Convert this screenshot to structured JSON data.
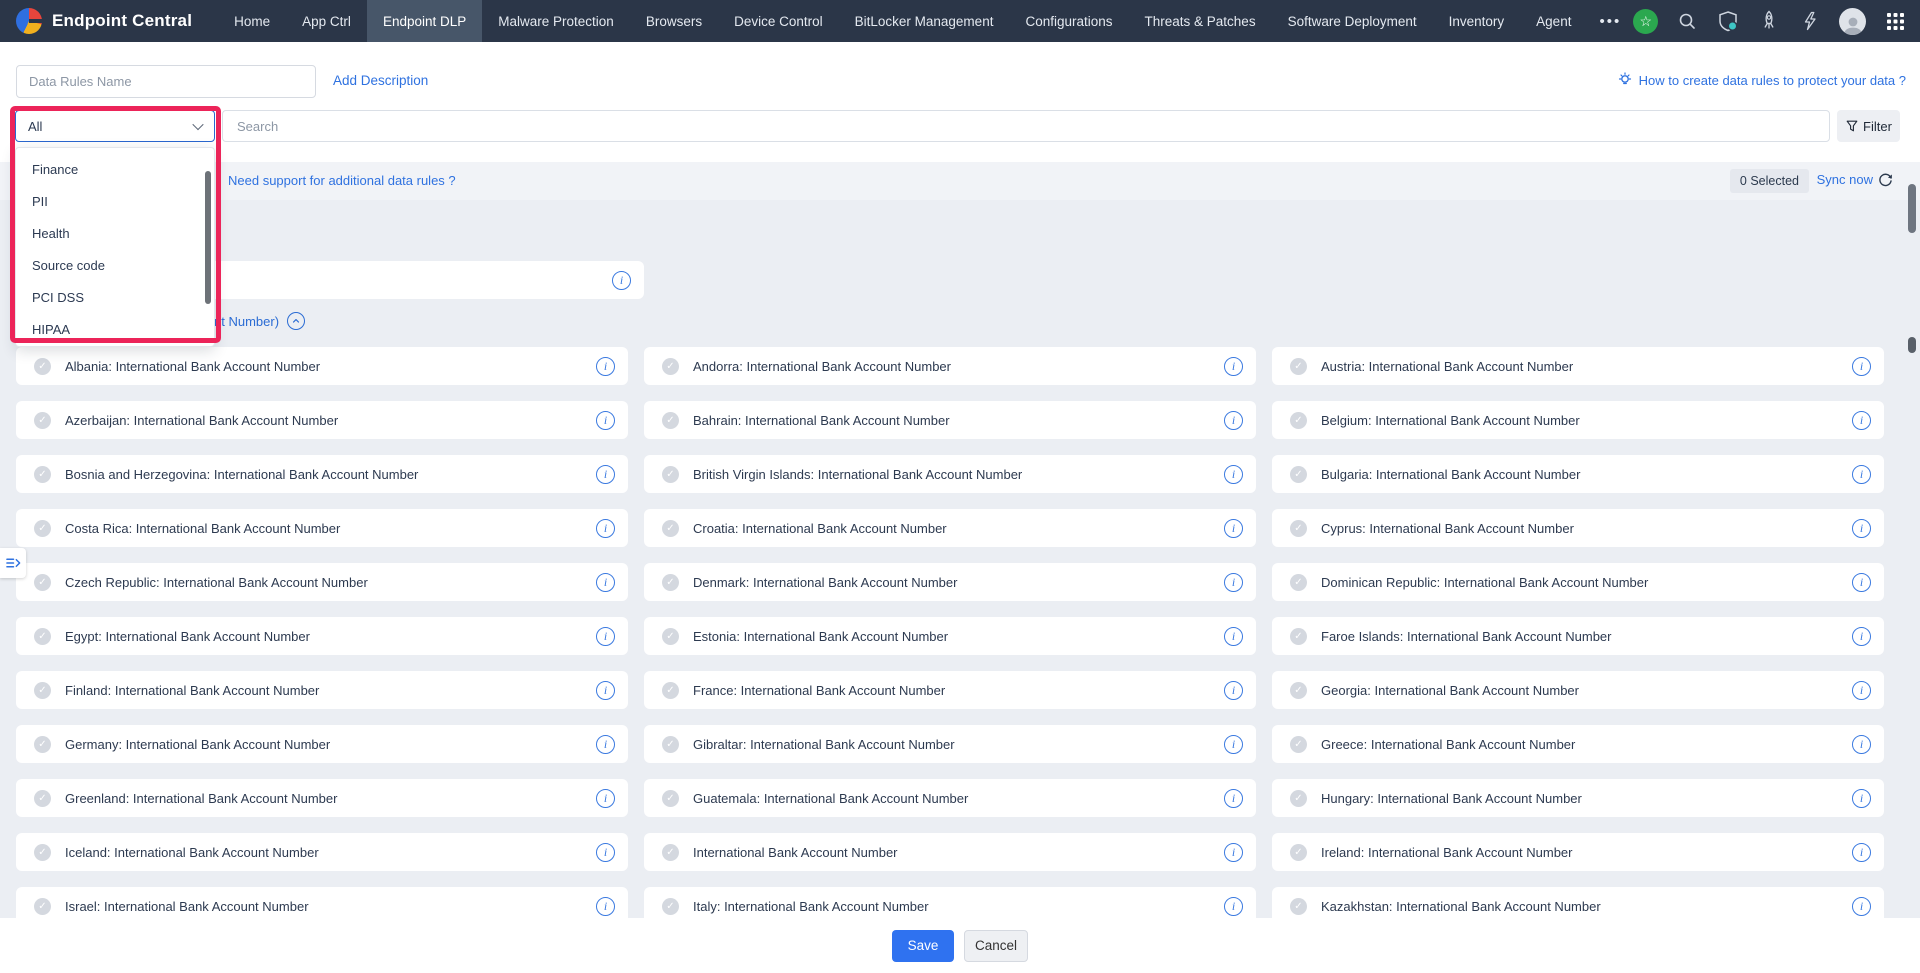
{
  "nav": {
    "brand": "Endpoint Central",
    "tabs": [
      {
        "label": "Home",
        "active": false
      },
      {
        "label": "App Ctrl",
        "active": false
      },
      {
        "label": "Endpoint DLP",
        "active": true
      },
      {
        "label": "Malware Protection",
        "active": false
      },
      {
        "label": "Browsers",
        "active": false
      },
      {
        "label": "Device Control",
        "active": false
      },
      {
        "label": "BitLocker Management",
        "active": false
      },
      {
        "label": "Configurations",
        "active": false
      },
      {
        "label": "Threats & Patches",
        "active": false
      },
      {
        "label": "Software Deployment",
        "active": false
      },
      {
        "label": "Inventory",
        "active": false
      },
      {
        "label": "Agent",
        "active": false
      }
    ],
    "more_label": "•••"
  },
  "toolbar": {
    "name_placeholder": "Data Rules Name",
    "add_description": "Add Description",
    "help_link": "How to create data rules to protect your data ?",
    "search_placeholder": "Search",
    "filter_label": "Filter"
  },
  "category_dropdown": {
    "value": "All",
    "options": [
      "Finance",
      "PII",
      "Health",
      "Source code",
      "PCI DSS",
      "HIPAA"
    ]
  },
  "support_bar": {
    "support_link": "Need support for additional data rules ?",
    "selected_count": "0 Selected",
    "sync_label": "Sync now"
  },
  "section": {
    "title": "Finance (International Bank Account Number)"
  },
  "rules": [
    "Albania: International Bank Account Number",
    "Andorra: International Bank Account Number",
    "Austria: International Bank Account Number",
    "Azerbaijan: International Bank Account Number",
    "Bahrain: International Bank Account Number",
    "Belgium: International Bank Account Number",
    "Bosnia and Herzegovina: International Bank Account Number",
    "British Virgin Islands: International Bank Account Number",
    "Bulgaria: International Bank Account Number",
    "Costa Rica: International Bank Account Number",
    "Croatia: International Bank Account Number",
    "Cyprus: International Bank Account Number",
    "Czech Republic: International Bank Account Number",
    "Denmark: International Bank Account Number",
    "Dominican Republic: International Bank Account Number",
    "Egypt: International Bank Account Number",
    "Estonia: International Bank Account Number",
    "Faroe Islands: International Bank Account Number",
    "Finland: International Bank Account Number",
    "France: International Bank Account Number",
    "Georgia: International Bank Account Number",
    "Germany: International Bank Account Number",
    "Gibraltar: International Bank Account Number",
    "Greece: International Bank Account Number",
    "Greenland: International Bank Account Number",
    "Guatemala: International Bank Account Number",
    "Hungary: International Bank Account Number",
    "Iceland: International Bank Account Number",
    "International Bank Account Number",
    "Ireland: International Bank Account Number",
    "Israel: International Bank Account Number",
    "Italy: International Bank Account Number",
    "Kazakhstan: International Bank Account Number"
  ],
  "footer": {
    "save": "Save",
    "cancel": "Cancel"
  },
  "colors": {
    "navbar": "#2b3648",
    "accent_blue": "#2f72e0",
    "save_blue": "#2f72f0",
    "annotation_pink": "#ec2459",
    "badge_green": "#2ba84f",
    "notification_teal": "#3ec6c6",
    "content_bg": "#ebeef3"
  }
}
